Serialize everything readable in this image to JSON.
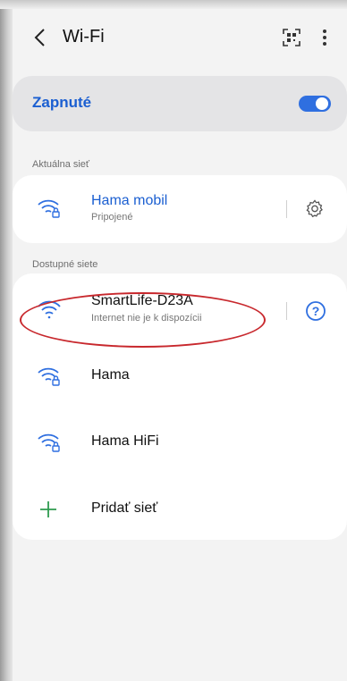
{
  "header": {
    "title": "Wi-Fi",
    "back_icon": "chevron-left-icon",
    "qr_icon": "qr-scan-icon",
    "more_icon": "more-vertical-icon"
  },
  "toggle": {
    "label": "Zapnuté",
    "state": "on"
  },
  "current_section": {
    "label": "Aktuálna sieť",
    "network": {
      "name": "Hama mobil",
      "status": "Pripojené",
      "icon": "wifi-lock-icon",
      "action_icon": "gear-icon"
    }
  },
  "available_section": {
    "label": "Dostupné siete",
    "networks": [
      {
        "name": "SmartLife-D23A",
        "status": "Internet nie je k dispozícii",
        "icon": "wifi-icon",
        "action_icon": "help-icon"
      },
      {
        "name": "Hama",
        "icon": "wifi-lock-icon"
      },
      {
        "name": "Hama HiFi",
        "icon": "wifi-lock-icon"
      }
    ],
    "add_network": {
      "label": "Pridať sieť",
      "icon": "plus-icon"
    }
  },
  "colors": {
    "accent": "#2f6fe0",
    "toggle_label": "#1b5fd1",
    "add_icon": "#2e9b4f",
    "annotation": "#c8282d"
  }
}
